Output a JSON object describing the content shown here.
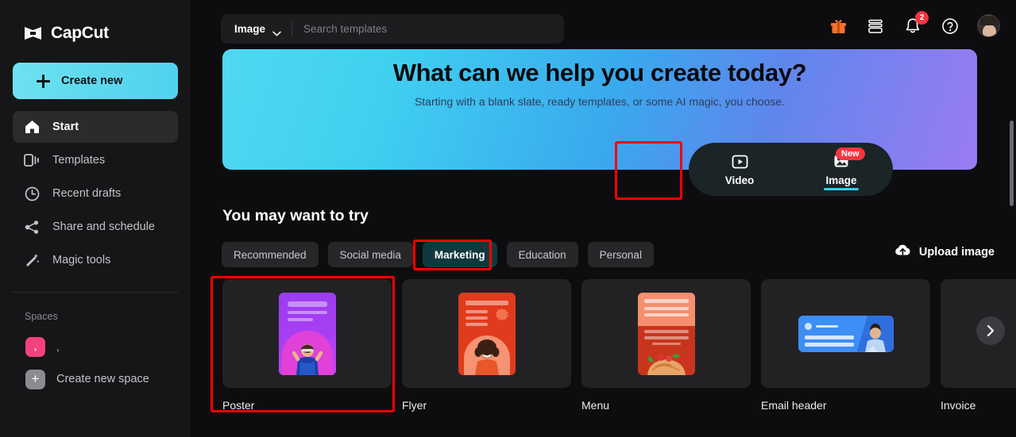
{
  "brand": {
    "name": "CapCut",
    "logo_icon": "capcut-logo-icon"
  },
  "sidebar": {
    "create_new": {
      "label": "Create new",
      "icon": "plus-icon"
    },
    "items": [
      {
        "label": "Start",
        "icon": "home-icon",
        "active": true
      },
      {
        "label": "Templates",
        "icon": "templates-icon",
        "active": false
      },
      {
        "label": "Recent drafts",
        "icon": "clock-icon",
        "active": false
      },
      {
        "label": "Share and schedule",
        "icon": "share-icon",
        "active": false
      },
      {
        "label": "Magic tools",
        "icon": "magic-wand-icon",
        "active": false
      }
    ],
    "spaces_title": "Spaces",
    "spaces": [
      {
        "label": ",",
        "chip": ",",
        "color": "#f2417e"
      }
    ],
    "create_space": {
      "label": "Create new space",
      "icon": "plus-icon"
    }
  },
  "topbar": {
    "search_type": "Image",
    "search_placeholder": "Search templates",
    "search_value": "",
    "icons": [
      {
        "name": "gift-icon",
        "color": "#f5722a"
      },
      {
        "name": "archive-icon",
        "color": "#ffffff"
      },
      {
        "name": "bell-icon",
        "color": "#ffffff",
        "badge": "2"
      },
      {
        "name": "help-icon",
        "color": "#ffffff"
      }
    ],
    "avatar": "user-avatar"
  },
  "hero": {
    "title": "What can we help you create today?",
    "subtitle": "Starting with a blank slate, ready templates, or some AI magic, you choose.",
    "gradient_from": "#4fd8f2",
    "gradient_to": "#9a7bf2"
  },
  "mode_pill": {
    "modes": [
      {
        "label": "Video",
        "icon": "video-play-icon",
        "active": false,
        "badge": ""
      },
      {
        "label": "Image",
        "icon": "image-icon",
        "active": true,
        "badge": "New"
      }
    ],
    "accent": "#2fd2e8"
  },
  "section": {
    "title": "You may want to try",
    "tabs": [
      {
        "label": "Recommended",
        "active": false
      },
      {
        "label": "Social media",
        "active": false
      },
      {
        "label": "Marketing",
        "active": true
      },
      {
        "label": "Education",
        "active": false
      },
      {
        "label": "Personal",
        "active": false
      }
    ],
    "upload": {
      "label": "Upload image",
      "icon": "cloud-upload-icon"
    },
    "cards": [
      {
        "label": "Poster",
        "art": "poster"
      },
      {
        "label": "Flyer",
        "art": "flyer"
      },
      {
        "label": "Menu",
        "art": "menu"
      },
      {
        "label": "Email header",
        "art": "email"
      },
      {
        "label": "Invoice",
        "art": "invoice"
      }
    ],
    "next_icon": "chevron-right-icon"
  },
  "annotations": {
    "color": "#ff0000",
    "boxes": [
      "image-mode-tab",
      "marketing-tab",
      "poster-card"
    ]
  }
}
